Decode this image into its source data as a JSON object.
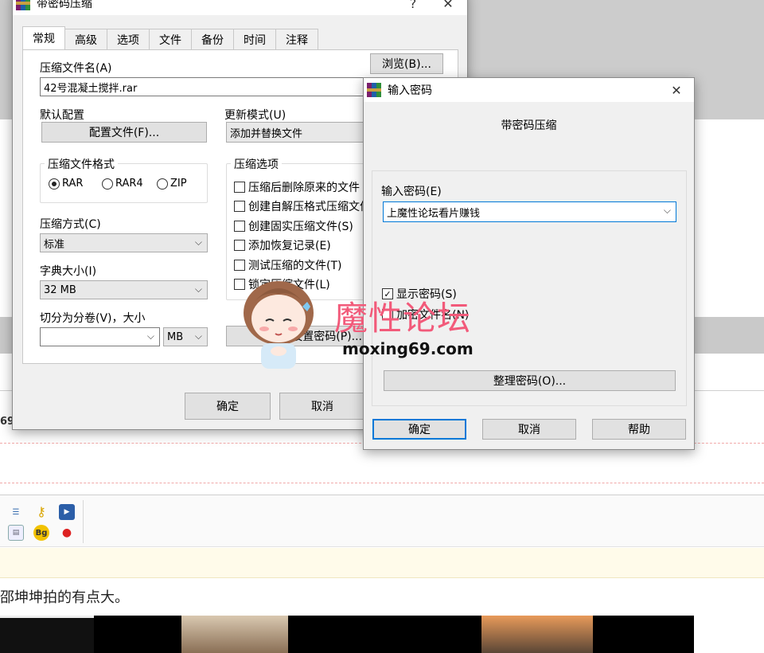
{
  "background": {
    "left_number": "69",
    "post_text": "邵坤坤拍的有点大。",
    "editor_icons": [
      "list-indent-icon",
      "key-icon",
      "video-icon",
      "table-icon",
      "bg-icon",
      "qq-icon"
    ],
    "editor_bg_label": "Bg"
  },
  "main_dialog": {
    "title": "带密码压缩",
    "help_glyph": "?",
    "close_glyph": "✕",
    "tabs": [
      {
        "label": "常规"
      },
      {
        "label": "高级"
      },
      {
        "label": "选项"
      },
      {
        "label": "文件"
      },
      {
        "label": "备份"
      },
      {
        "label": "时间"
      },
      {
        "label": "注释"
      }
    ],
    "archive_name_label": "压缩文件名(A)",
    "archive_name_value": "42号混凝土搅拌.rar",
    "browse_button": "浏览(B)...",
    "default_profile_label": "默认配置",
    "profiles_button": "配置文件(F)...",
    "update_mode_label": "更新模式(U)",
    "update_mode_value": "添加并替换文件",
    "format_group_title": "压缩文件格式",
    "formats": [
      {
        "label": "RAR",
        "selected": true
      },
      {
        "label": "RAR4",
        "selected": false
      },
      {
        "label": "ZIP",
        "selected": false
      }
    ],
    "options_group_title": "压缩选项",
    "options": [
      {
        "label": "压缩后删除原来的文件",
        "checked": false
      },
      {
        "label": "创建自解压格式压缩文件",
        "checked": false
      },
      {
        "label": "创建固实压缩文件(S)",
        "checked": false
      },
      {
        "label": "添加恢复记录(E)",
        "checked": false
      },
      {
        "label": "测试压缩的文件(T)",
        "checked": false
      },
      {
        "label": "锁定压缩文件(L)",
        "checked": false
      }
    ],
    "method_label": "压缩方式(C)",
    "method_value": "标准",
    "dict_label": "字典大小(I)",
    "dict_value": "32 MB",
    "split_label": "切分为分卷(V)，大小",
    "split_value": "",
    "split_unit": "MB",
    "set_password_button": "设置密码(P)...",
    "ok_button": "确定",
    "cancel_button": "取消"
  },
  "password_dialog": {
    "title": "输入密码",
    "close_glyph": "✕",
    "heading": "带密码压缩",
    "password_label": "输入密码(E)",
    "password_value": "上魔性论坛看片赚钱",
    "show_password_label": "显示密码(S)",
    "show_password_checked": true,
    "encrypt_names_label": "加密文件名(N)",
    "encrypt_names_checked": false,
    "organize_button": "整理密码(O)...",
    "ok_button": "确定",
    "cancel_button": "取消",
    "help_button": "帮助"
  },
  "watermark": {
    "text": "魔性论坛",
    "url": "moxing69.com"
  },
  "colors": {
    "accent_blue": "#0078d7",
    "watermark_pink": "#f25a7a",
    "dialog_bg": "#f0f0f0"
  }
}
